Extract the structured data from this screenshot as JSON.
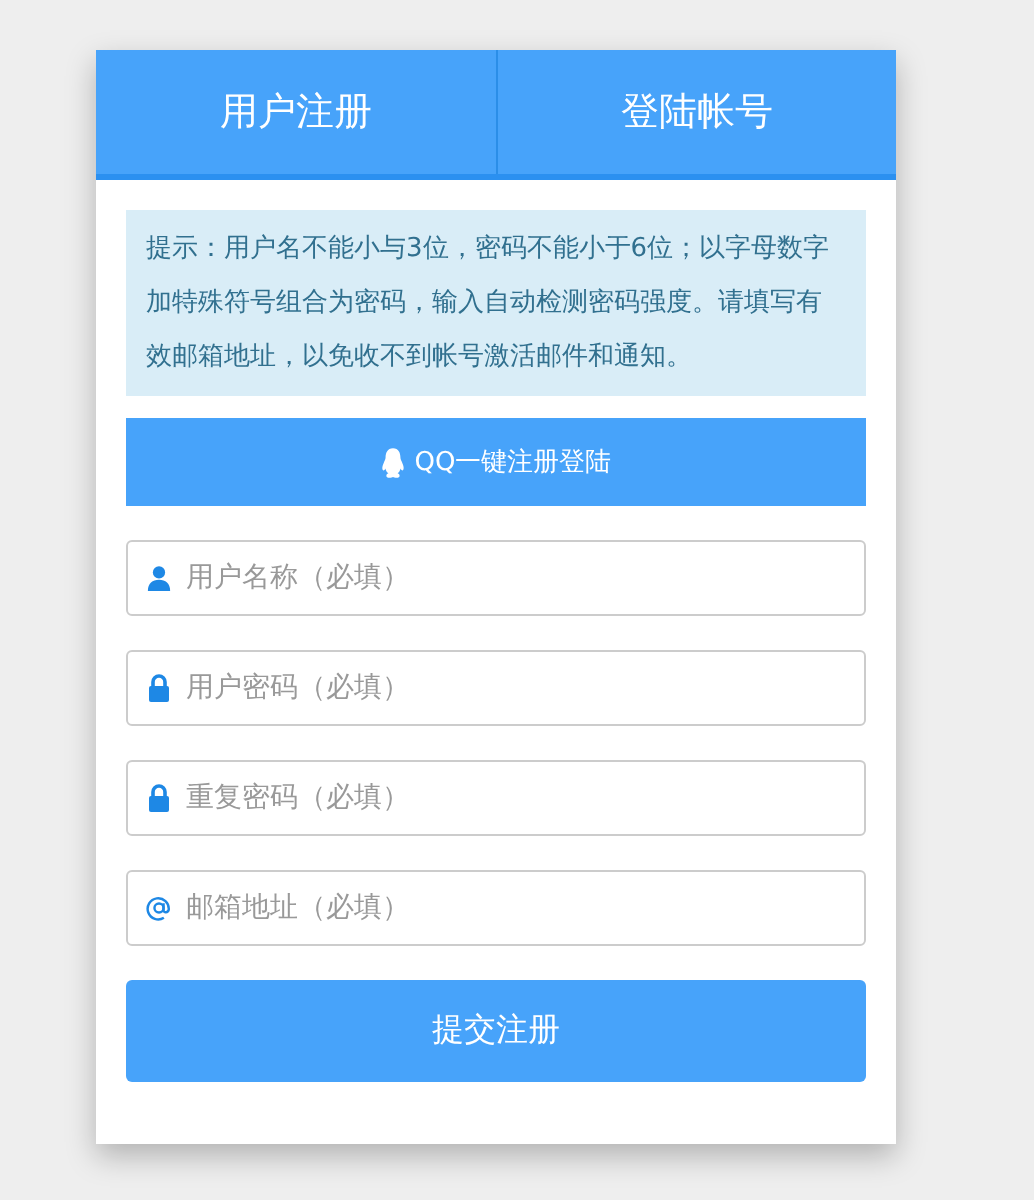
{
  "tabs": [
    {
      "label": "用户注册"
    },
    {
      "label": "登陆帐号"
    }
  ],
  "notice": "提示：用户名不能小与3位，密码不能小于6位；以字母数字加特殊符号组合为密码，输入自动检测密码强度。请填写有效邮箱地址，以免收不到帐号激活邮件和通知。",
  "qq_button": "QQ一键注册登陆",
  "fields": [
    {
      "kind": "user",
      "placeholder": "用户名称（必填）"
    },
    {
      "kind": "lock",
      "placeholder": "用户密码（必填）"
    },
    {
      "kind": "lock",
      "placeholder": "重复密码（必填）"
    },
    {
      "kind": "email",
      "placeholder": "邮箱地址（必填）"
    }
  ],
  "submit_button": "提交注册"
}
